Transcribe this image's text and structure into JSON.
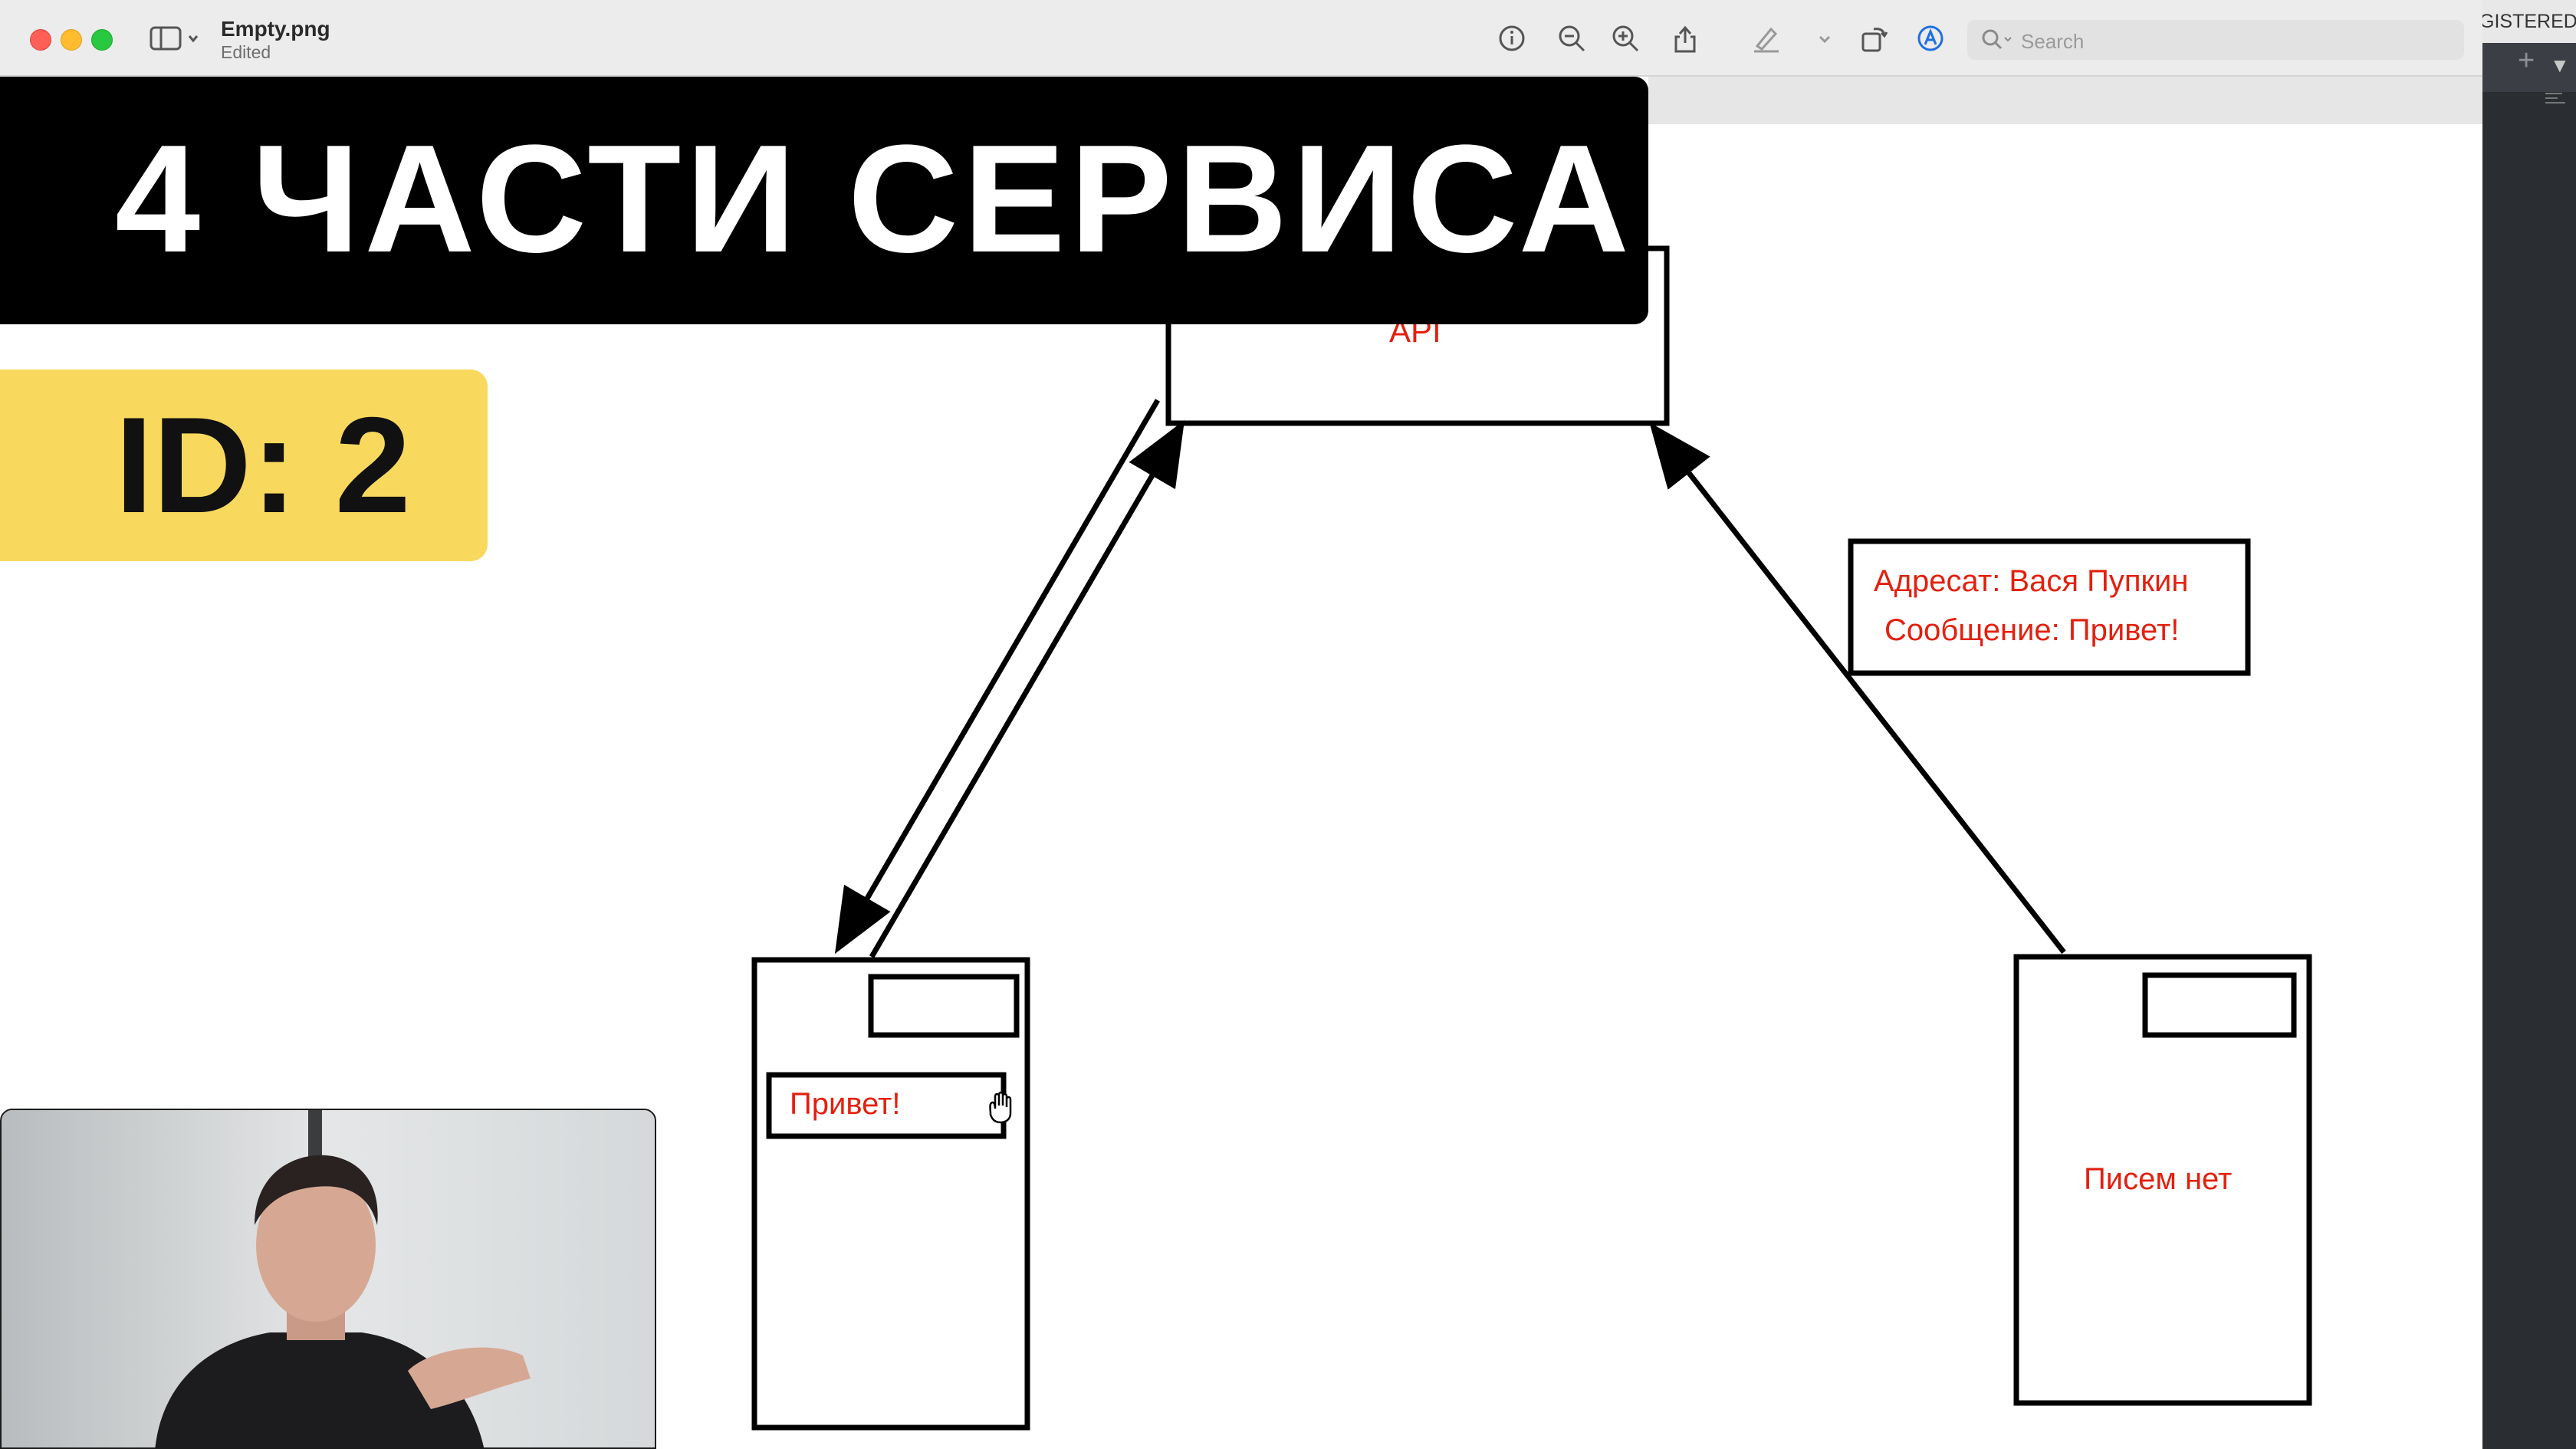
{
  "window": {
    "file_name": "Empty.png",
    "status": "Edited",
    "search_placeholder": "Search"
  },
  "right_panel": {
    "top_text": "GISTERED",
    "plus": "+",
    "caret": "▼"
  },
  "overlay": {
    "title": "4 ЧАСТИ СЕРВИСА",
    "id_label": "ID: 2"
  },
  "diagram": {
    "api_label": "API",
    "message_box": {
      "line1": "Адресат: Вася Пупкин",
      "line2": "Сообщение: Привет!"
    },
    "left_client": {
      "input_text": "Привет!"
    },
    "right_client": {
      "status_text": "Писем нет"
    }
  },
  "icons": [
    "sidebar-toggle-icon",
    "info-icon",
    "zoom-out-icon",
    "zoom-in-icon",
    "share-icon",
    "markup-pen-icon",
    "rotate-icon",
    "annotate-icon",
    "search-icon",
    "hand-cursor-icon"
  ],
  "colors": {
    "label_red": "#e3200e",
    "title_banner_bg": "#000000",
    "id_badge_bg": "#f9d95d"
  }
}
